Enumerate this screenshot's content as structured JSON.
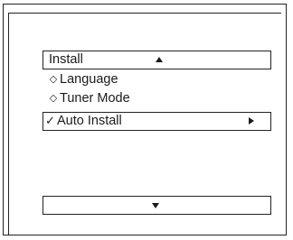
{
  "menu": {
    "title": "Install",
    "items": [
      {
        "label": "Language",
        "marker": "◇",
        "selected": false
      },
      {
        "label": "Tuner Mode",
        "marker": "◇",
        "selected": false
      },
      {
        "label": "Auto Install",
        "marker": "✓",
        "selected": true
      }
    ]
  },
  "icons": {
    "scroll_up": "up-arrow-icon",
    "scroll_down": "down-arrow-icon",
    "submenu": "right-arrow-icon"
  }
}
